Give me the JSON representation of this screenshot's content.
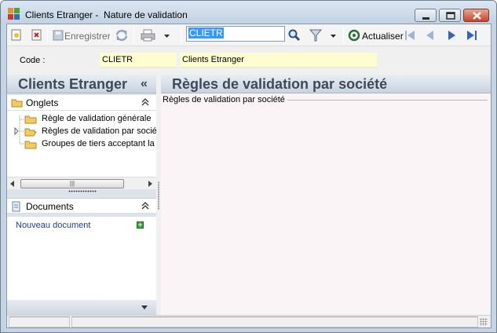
{
  "window": {
    "title": "Clients Etranger -  Nature de validation",
    "minimize_label": "Minimize",
    "maximize_label": "Maximize",
    "close_label": "Close"
  },
  "toolbar": {
    "save_label": "Enregistrer",
    "search_value": "CLIETR",
    "refresh_label": "Actualiser"
  },
  "code": {
    "label": "Code :",
    "value": "CLIETR",
    "description": "Clients Etranger"
  },
  "left_panel": {
    "title": "Clients Etranger",
    "collapse_glyph": "«",
    "onglets": {
      "title": "Onglets",
      "items": [
        {
          "label": "Règle de validation générale"
        },
        {
          "label": "Règles de validation par société"
        },
        {
          "label": "Groupes de tiers acceptant la n"
        }
      ]
    },
    "documents": {
      "title": "Documents",
      "new_document": "Nouveau document"
    }
  },
  "right_panel": {
    "title": "Règles de validation par société",
    "group_label": "Règles de validation par société"
  },
  "colors": {
    "header_text": "#3d4a5a",
    "link": "#1f3b9b",
    "field_bg": "#fdfdcf",
    "selection": "#3399ff"
  }
}
